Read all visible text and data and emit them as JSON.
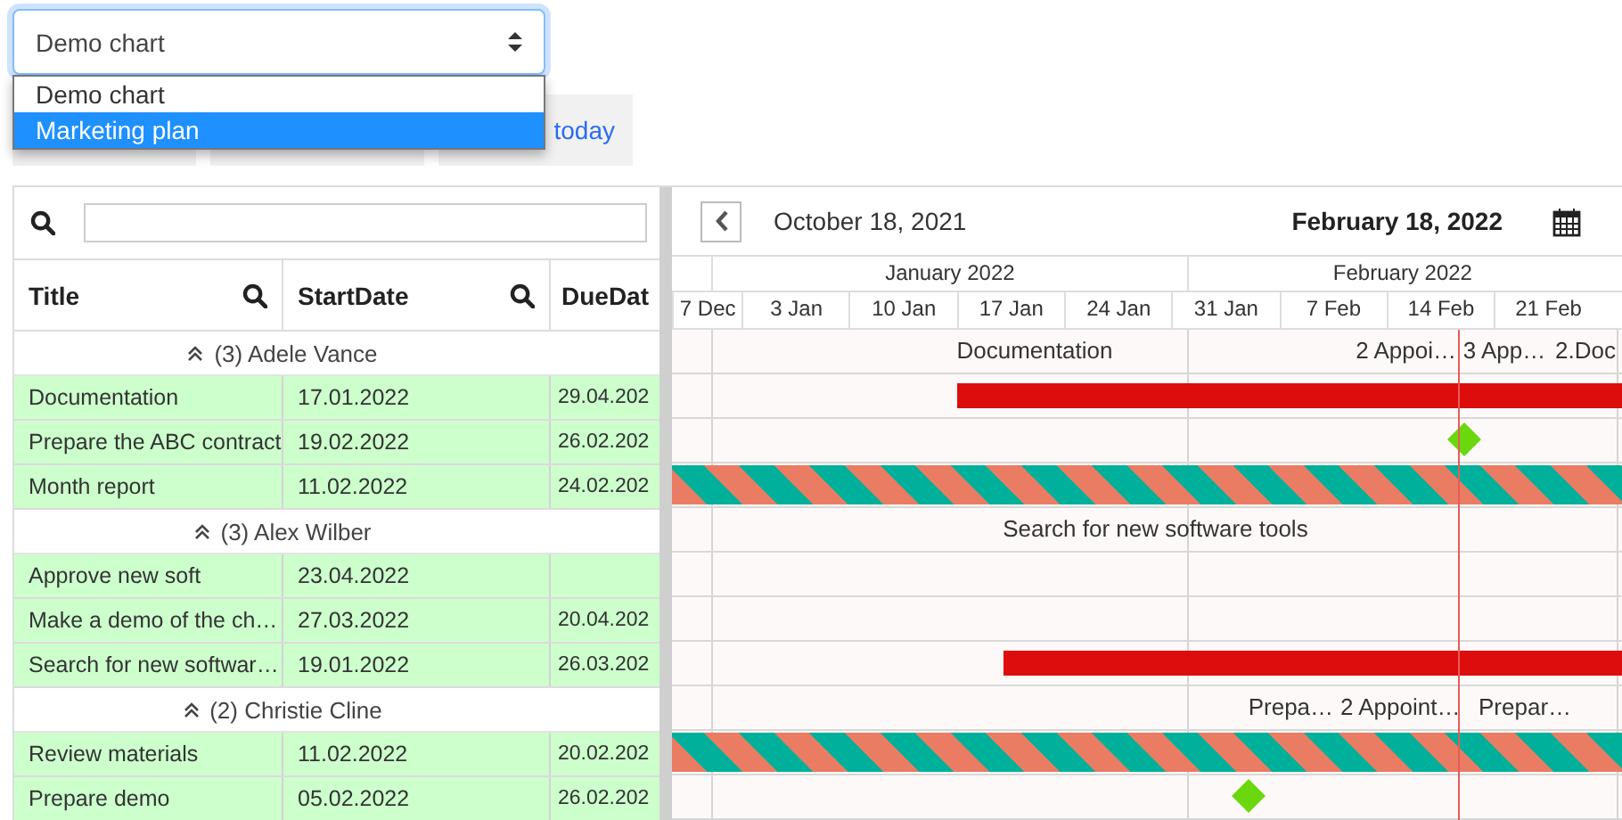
{
  "chart_select": {
    "value": "Demo chart",
    "options": [
      {
        "label": "Demo chart",
        "highlighted": false
      },
      {
        "label": "Marketing plan",
        "highlighted": true
      }
    ]
  },
  "today_button": {
    "label": "today"
  },
  "grid": {
    "columns": [
      {
        "title": "Title",
        "search_icon": true
      },
      {
        "title": "StartDate",
        "search_icon": true
      },
      {
        "title": "DueDat",
        "search_icon": false
      }
    ],
    "rows": [
      {
        "kind": "group",
        "label": "(3) Adele Vance",
        "expanded": true,
        "timeline": [
          {
            "kind": "label",
            "text": "Documentation"
          },
          {
            "kind": "label",
            "text": "2 Appoi…"
          },
          {
            "kind": "label",
            "text": "3 App…"
          },
          {
            "kind": "label",
            "text": "2.Doc"
          }
        ]
      },
      {
        "kind": "task",
        "cells": [
          "Documentation",
          "17.01.2022",
          "29.04.202"
        ],
        "timeline": [
          {
            "kind": "bar"
          }
        ]
      },
      {
        "kind": "task",
        "cells": [
          "Prepare the ABC contract",
          "19.02.2022",
          "26.02.202"
        ],
        "timeline": [
          {
            "kind": "milestone"
          }
        ]
      },
      {
        "kind": "task",
        "cells": [
          "Month report",
          "11.02.2022",
          "24.02.202"
        ],
        "timeline": [
          {
            "kind": "striped"
          }
        ]
      },
      {
        "kind": "group",
        "label": "(3) Alex Wilber",
        "expanded": true,
        "timeline": [
          {
            "kind": "label",
            "text": "Search for new software tools"
          }
        ]
      },
      {
        "kind": "task",
        "cells": [
          "Approve new soft",
          "23.04.2022"
        ],
        "timeline": []
      },
      {
        "kind": "task",
        "cells": [
          "Make a demo of the ch…",
          "27.03.2022",
          "20.04.202"
        ],
        "timeline": []
      },
      {
        "kind": "task",
        "cells": [
          "Search for new softwar…",
          "19.01.2022",
          "26.03.202"
        ],
        "timeline": [
          {
            "kind": "bar"
          }
        ]
      },
      {
        "kind": "group",
        "label": "(2) Christie Cline",
        "expanded": true,
        "timeline": [
          {
            "kind": "label",
            "text": "Prepa…"
          },
          {
            "kind": "label",
            "text": "2 Appoint…"
          },
          {
            "kind": "label",
            "text": "Prepar…"
          }
        ]
      },
      {
        "kind": "task",
        "cells": [
          "Review materials",
          "11.02.2022",
          "20.02.202"
        ],
        "timeline": [
          {
            "kind": "striped"
          }
        ]
      },
      {
        "kind": "task",
        "cells": [
          "Prepare demo",
          "05.02.2022",
          "26.02.202"
        ],
        "timeline": [
          {
            "kind": "milestone"
          }
        ]
      }
    ]
  },
  "gantt": {
    "range_start": "October 18, 2021",
    "range_end": "February 18, 2022",
    "months": [
      {
        "label": "January 2022"
      },
      {
        "label": "February 2022"
      }
    ],
    "weeks": [
      {
        "label": "7 Dec"
      },
      {
        "label": "3 Jan"
      },
      {
        "label": "10 Jan"
      },
      {
        "label": "17 Jan"
      },
      {
        "label": "24 Jan"
      },
      {
        "label": "31 Jan"
      },
      {
        "label": "7 Feb"
      },
      {
        "label": "14 Feb"
      },
      {
        "label": "21 Feb"
      }
    ]
  }
}
